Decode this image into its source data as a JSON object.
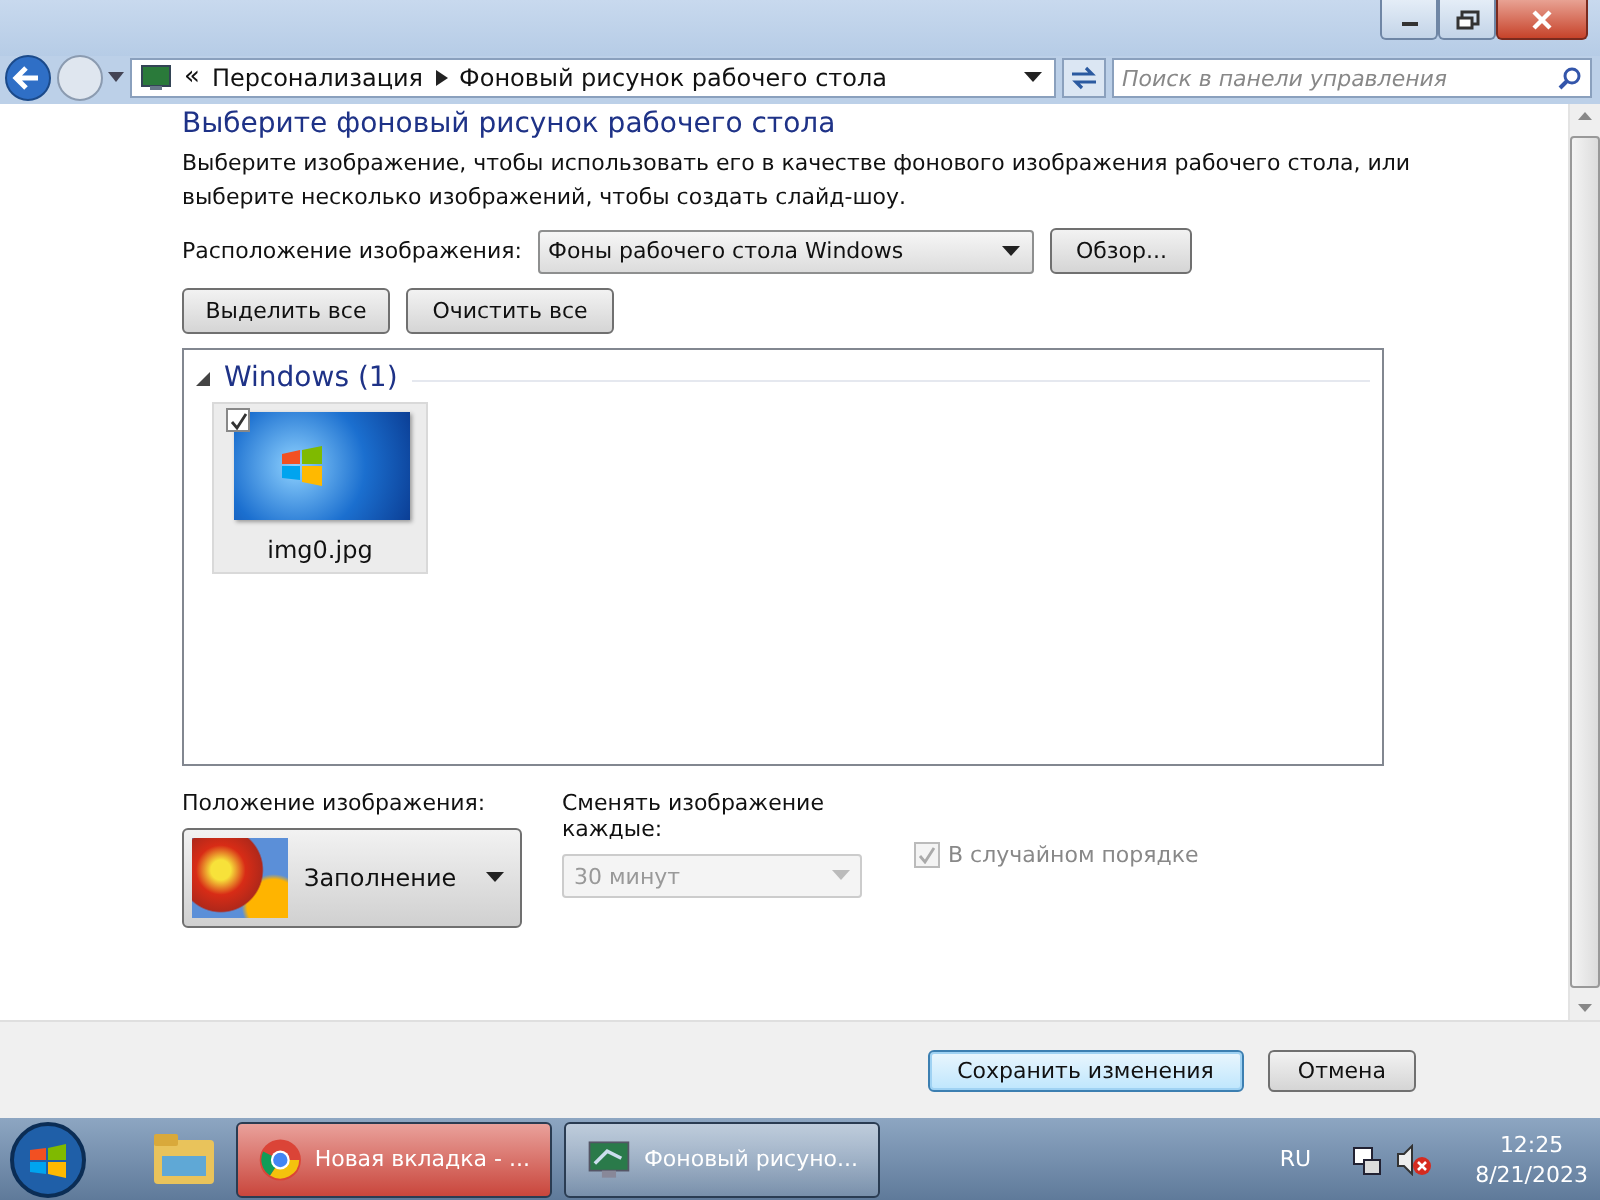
{
  "address_bar": {
    "overflow": "«",
    "breadcrumbs": [
      "Персонализация",
      "Фоновый рисунок рабочего стола"
    ],
    "search": {
      "placeholder": "Поиск в панели управления"
    }
  },
  "heading": "Выберите фоновый рисунок рабочего стола",
  "description": "Выберите изображение, чтобы использовать его в качестве фонового изображения рабочего стола, или выберите несколько изображений, чтобы создать слайд-шоу.",
  "location": {
    "label": "Расположение изображения:",
    "value": "Фоны рабочего стола Windows",
    "browse": "Обзор..."
  },
  "select_buttons": [
    "Выделить все",
    "Очистить все"
  ],
  "groups": [
    {
      "title": "Windows (1)",
      "expanded": true,
      "items": [
        {
          "name": "img0.jpg",
          "checked": true,
          "selected": true
        }
      ]
    }
  ],
  "position": {
    "label": "Положение изображения:",
    "value": "Заполнение"
  },
  "interval": {
    "label": "Сменять изображение каждые:",
    "value": "30 минут",
    "disabled": true
  },
  "shuffle": {
    "label": "В случайном порядке",
    "checked": true,
    "disabled": true
  },
  "footer_buttons": [
    {
      "label": "Сохранить изменения",
      "default": true
    },
    {
      "label": "Отмена",
      "default": false
    }
  ],
  "taskbar": {
    "buttons": [
      {
        "kind": "chrome",
        "label": "Новая вкладка - ...",
        "attention": true
      },
      {
        "kind": "wallpaper",
        "label": "Фоновый рисуно...",
        "attention": false
      }
    ],
    "language": "RU",
    "time": "12:25",
    "date": "8/21/2023"
  }
}
